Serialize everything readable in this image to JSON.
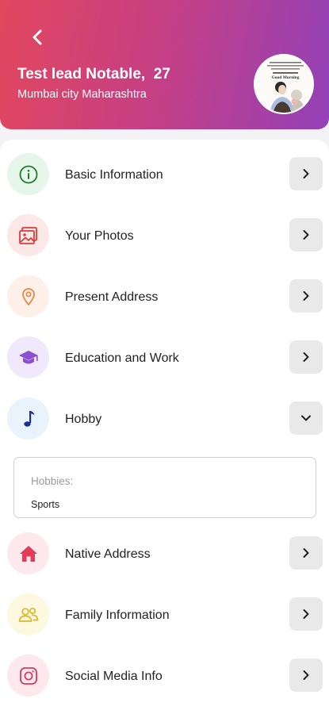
{
  "profile": {
    "name": "Test lead Notable,",
    "age": "27",
    "location": "Mumbai city Maharashtra",
    "avatar_icon": "profile-photo-illustration",
    "avatar_text": [
      "Good Morning"
    ]
  },
  "colors": {
    "header_gradient": [
      "#e2475e",
      "#c43f86",
      "#9241b8"
    ]
  },
  "sections": [
    {
      "label": "Basic Information",
      "icon": "info-icon",
      "icon_color": "#1e7a2a",
      "bg_color": "#e6f6ea",
      "state": "collapsed"
    },
    {
      "label": "Your Photos",
      "icon": "photos-icon",
      "icon_color": "#e03a3a",
      "bg_color": "#fde8e8",
      "state": "collapsed"
    },
    {
      "label": "Present Address",
      "icon": "location-pin-icon",
      "icon_color": "#e8874a",
      "bg_color": "#fdf0e8",
      "state": "collapsed"
    },
    {
      "label": "Education and Work",
      "icon": "graduation-cap-icon",
      "icon_color": "#8a4fd0",
      "bg_color": "#efe9fb",
      "state": "collapsed"
    },
    {
      "label": "Hobby",
      "icon": "music-note-icon",
      "icon_color": "#1c2f8f",
      "bg_color": "#e8f3fb",
      "state": "expanded"
    },
    {
      "label": "Native Address",
      "icon": "home-icon",
      "icon_color": "#e23b5c",
      "bg_color": "#fde8ee",
      "state": "collapsed"
    },
    {
      "label": "Family Information",
      "icon": "people-icon",
      "icon_color": "#e0b52a",
      "bg_color": "#fdf8e0",
      "state": "collapsed"
    },
    {
      "label": "Social Media Info",
      "icon": "instagram-icon",
      "icon_color": "#d43b62",
      "bg_color": "#fde8ee",
      "state": "collapsed"
    }
  ],
  "hobby": {
    "key": "Hobbies:",
    "value": "Sports"
  }
}
